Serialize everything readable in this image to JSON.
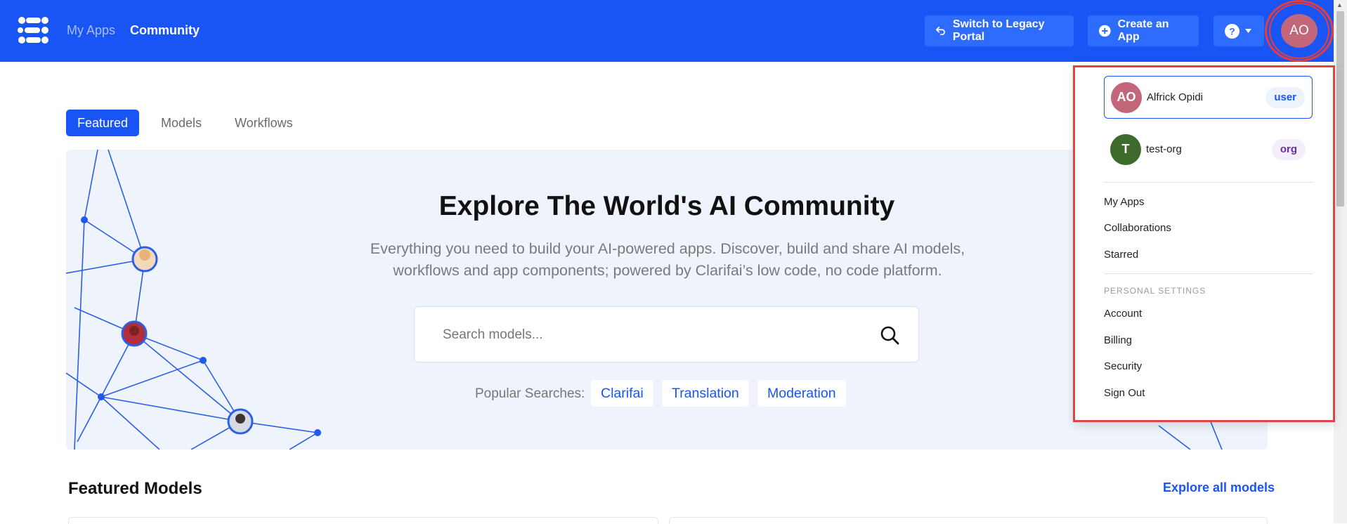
{
  "header": {
    "nav": [
      {
        "label": "My Apps",
        "active": false
      },
      {
        "label": "Community",
        "active": true
      }
    ],
    "legacy_button": "Switch to Legacy Portal",
    "create_button": "Create an App",
    "avatar_initials": "AO"
  },
  "tabs": [
    {
      "label": "Featured",
      "active": true
    },
    {
      "label": "Models",
      "active": false
    },
    {
      "label": "Workflows",
      "active": false
    }
  ],
  "hero": {
    "title": "Explore The World's AI Community",
    "subtitle_line1": "Everything you need to build your AI-powered apps. Discover, build and share AI models,",
    "subtitle_line2": "workflows and app components; powered by Clarifai’s low code, no code platform.",
    "search_placeholder": "Search models...",
    "popular_label": "Popular Searches:",
    "popular": [
      "Clarifai",
      "Translation",
      "Moderation"
    ]
  },
  "featured": {
    "title": "Featured Models",
    "explore_link": "Explore all models"
  },
  "dropdown": {
    "accounts": [
      {
        "initials": "AO",
        "name": "Alfrick Opidi",
        "badge": "user",
        "color": "#c2667a",
        "selected": true
      },
      {
        "initials": "T",
        "name": "test-org",
        "badge": "org",
        "color": "#3e6b2c",
        "selected": false
      }
    ],
    "menu": [
      "My Apps",
      "Collaborations",
      "Starred"
    ],
    "settings_heading": "PERSONAL SETTINGS",
    "settings": [
      "Account",
      "Billing",
      "Security",
      "Sign Out"
    ]
  },
  "colors": {
    "brand": "#1955f5",
    "highlight_outline": "#e04545",
    "user_badge_bg": "#edf3fd",
    "org_badge_bg": "#f4eefb",
    "org_badge_text": "#6a2ea6"
  }
}
